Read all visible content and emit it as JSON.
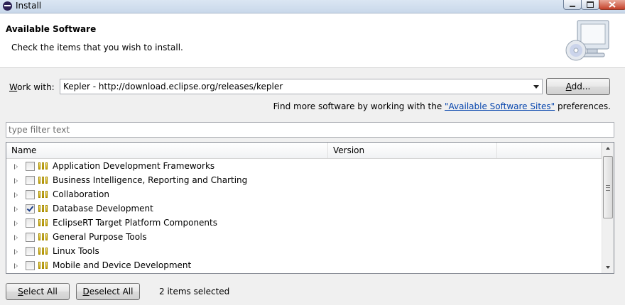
{
  "window": {
    "title": "Install",
    "controls": [
      "minimize",
      "maximize",
      "close"
    ]
  },
  "header": {
    "title": "Available Software",
    "description": "Check the items that you wish to install.",
    "icon": "monitor-cd-icon"
  },
  "work_with": {
    "label": "Work with:",
    "mnemonic": "W",
    "value": "Kepler - http://download.eclipse.org/releases/kepler",
    "add_label": "Add...",
    "add_mnemonic": "A"
  },
  "find_more": {
    "prefix": "Find more software by working with the ",
    "link": "\"Available Software Sites\"",
    "suffix": " preferences."
  },
  "filter": {
    "placeholder": "type filter text",
    "value": ""
  },
  "table": {
    "columns": [
      "Name",
      "Version",
      ""
    ],
    "rows": [
      {
        "label": "Application Development Frameworks",
        "checked": false
      },
      {
        "label": "Business Intelligence, Reporting and Charting",
        "checked": false
      },
      {
        "label": "Collaboration",
        "checked": false
      },
      {
        "label": "Database Development",
        "checked": true
      },
      {
        "label": "EclipseRT Target Platform Components",
        "checked": false
      },
      {
        "label": "General Purpose Tools",
        "checked": false
      },
      {
        "label": "Linux Tools",
        "checked": false
      },
      {
        "label": "Mobile and Device Development",
        "checked": false
      }
    ]
  },
  "footer": {
    "select_all": "Select All",
    "select_all_mnemonic": "S",
    "deselect_all": "Deselect All",
    "deselect_all_mnemonic": "D",
    "status": "2 items selected"
  },
  "colors": {
    "link": "#0645ad",
    "window_bg": "#f0f0f0",
    "category_icon": "#e0c21a"
  }
}
